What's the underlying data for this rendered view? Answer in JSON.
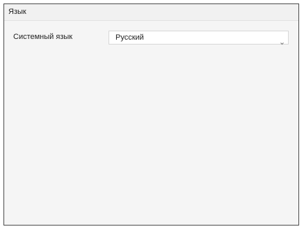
{
  "panel": {
    "title": "Язык"
  },
  "language_setting": {
    "label": "Системный язык",
    "selected_value": "Русский",
    "arrow_icon": "chevron-down-icon"
  }
}
